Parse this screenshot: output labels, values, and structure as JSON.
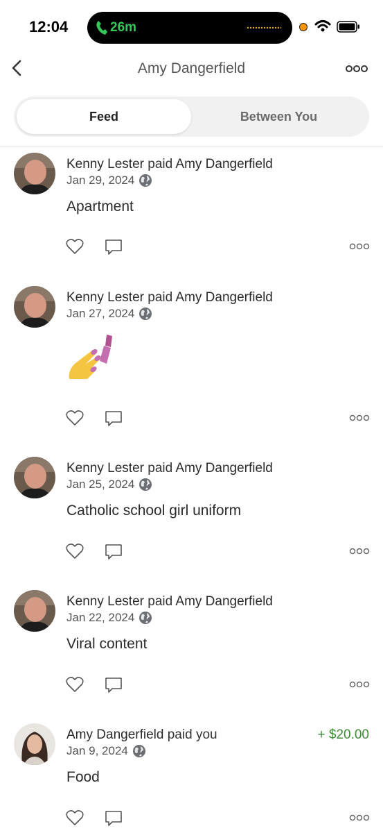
{
  "status_bar": {
    "time": "12:04",
    "call_duration": "26m"
  },
  "header": {
    "title": "Amy Dangerfield"
  },
  "tabs": [
    {
      "label": "Feed",
      "selected": true
    },
    {
      "label": "Between You",
      "selected": false
    }
  ],
  "feed": [
    {
      "payer": "Kenny Lester",
      "verb": "paid",
      "payee": "Amy Dangerfield",
      "date": "Jan 29, 2024",
      "note": "Apartment"
    },
    {
      "payer": "Kenny Lester",
      "verb": "paid",
      "payee": "Amy Dangerfield",
      "date": "Jan 27, 2024",
      "note_icon": "nail-polish-emoji"
    },
    {
      "payer": "Kenny Lester",
      "verb": "paid",
      "payee": "Amy Dangerfield",
      "date": "Jan 25, 2024",
      "note": "Catholic school girl uniform"
    },
    {
      "payer": "Kenny Lester",
      "verb": "paid",
      "payee": "Amy Dangerfield",
      "date": "Jan 22, 2024",
      "note": "Viral content"
    },
    {
      "payer": "Amy Dangerfield",
      "verb": "paid",
      "payee": "you",
      "date": "Jan 9, 2024",
      "note": "Food",
      "amount": "+ $20.00"
    }
  ],
  "colors": {
    "accent_green": "#3d8b35",
    "call_green": "#35c759"
  }
}
